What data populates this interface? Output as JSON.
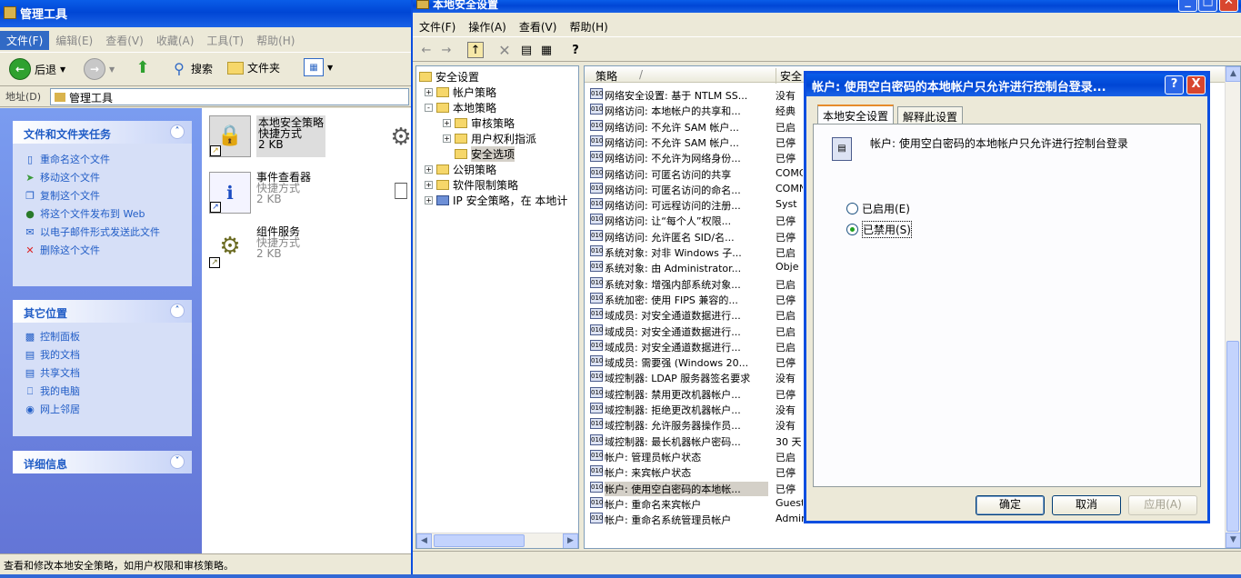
{
  "admin": {
    "title": "管理工具",
    "menu": [
      "文件(F)",
      "编辑(E)",
      "查看(V)",
      "收藏(A)",
      "工具(T)",
      "帮助(H)"
    ],
    "toolbar": {
      "back": "后退",
      "search": "搜索",
      "folders": "文件夹"
    },
    "address_label": "地址(D)",
    "address_value": "管理工具",
    "tasks": {
      "title": "文件和文件夹任务",
      "items": [
        "重命名这个文件",
        "移动这个文件",
        "复制这个文件",
        "将这个文件发布到 Web",
        "以电子邮件形式发送此文件",
        "删除这个文件"
      ]
    },
    "places": {
      "title": "其它位置",
      "items": [
        "控制面板",
        "我的文档",
        "共享文档",
        "我的电脑",
        "网上邻居"
      ]
    },
    "details": {
      "title": "详细信息"
    },
    "files": [
      {
        "name": "本地安全策略",
        "type": "快捷方式",
        "size": "2 KB"
      },
      {
        "name": "事件查看器",
        "type": "快捷方式",
        "size": "2 KB"
      },
      {
        "name": "组件服务",
        "type": "快捷方式",
        "size": "2 KB"
      }
    ],
    "status": "查看和修改本地安全策略，如用户权限和审核策略。"
  },
  "secpol": {
    "title": "本地安全设置",
    "menu": [
      "文件(F)",
      "操作(A)",
      "查看(V)",
      "帮助(H)"
    ],
    "tree": [
      {
        "label": "安全设置"
      },
      {
        "label": "帐户策略"
      },
      {
        "label": "本地策略"
      },
      {
        "label": "审核策略"
      },
      {
        "label": "用户权利指派"
      },
      {
        "label": "安全选项"
      },
      {
        "label": "公钥策略"
      },
      {
        "label": "软件限制策略"
      },
      {
        "label": "IP 安全策略，在 本地计"
      }
    ],
    "columns": {
      "policy": "策略",
      "setting": "安全"
    },
    "rows": [
      {
        "policy": "网络安全设置: 基于 NTLM SS...",
        "setting": "没有"
      },
      {
        "policy": "网络访问: 本地帐户的共享和...",
        "setting": "经典"
      },
      {
        "policy": "网络访问: 不允许 SAM 帐户...",
        "setting": "已启"
      },
      {
        "policy": "网络访问: 不允许 SAM 帐户...",
        "setting": "已停"
      },
      {
        "policy": "网络访问: 不允许为网络身份...",
        "setting": "已停"
      },
      {
        "policy": "网络访问: 可匿名访问的共享",
        "setting": "COMC"
      },
      {
        "policy": "网络访问: 可匿名访问的命名...",
        "setting": "COMN"
      },
      {
        "policy": "网络访问: 可远程访问的注册...",
        "setting": "Syst"
      },
      {
        "policy": "网络访问: 让“每个人”权限...",
        "setting": "已停"
      },
      {
        "policy": "网络访问: 允许匿名 SID/名...",
        "setting": "已停"
      },
      {
        "policy": "系统对象: 对非 Windows 子...",
        "setting": "已启"
      },
      {
        "policy": "系统对象: 由 Administrator...",
        "setting": "Obje"
      },
      {
        "policy": "系统对象: 增强内部系统对象...",
        "setting": "已启"
      },
      {
        "policy": "系统加密: 使用 FIPS 兼容的...",
        "setting": "已停"
      },
      {
        "policy": "域成员: 对安全通道数据进行...",
        "setting": "已启"
      },
      {
        "policy": "域成员: 对安全通道数据进行...",
        "setting": "已启"
      },
      {
        "policy": "域成员: 对安全通道数据进行...",
        "setting": "已启"
      },
      {
        "policy": "域成员: 需要强 (Windows 20...",
        "setting": "已停"
      },
      {
        "policy": "域控制器: LDAP 服务器签名要求",
        "setting": "没有"
      },
      {
        "policy": "域控制器: 禁用更改机器帐户...",
        "setting": "已停"
      },
      {
        "policy": "域控制器: 拒绝更改机器帐户...",
        "setting": "没有"
      },
      {
        "policy": "域控制器: 允许服务器操作员...",
        "setting": "没有"
      },
      {
        "policy": "域控制器: 最长机器帐户密码...",
        "setting": "30 天"
      },
      {
        "policy": "帐户: 管理员帐户状态",
        "setting": "已启"
      },
      {
        "policy": "帐户: 来宾帐户状态",
        "setting": "已停"
      },
      {
        "policy": "帐户: 使用空白密码的本地帐...",
        "setting": "已停"
      },
      {
        "policy": "帐户: 重命名来宾帐户",
        "setting": "Guest"
      },
      {
        "policy": "帐户: 重命名系统管理员帐户",
        "setting": "Administrator"
      }
    ]
  },
  "dialog": {
    "title": "帐户: 使用空白密码的本地帐户只允许进行控制台登录...",
    "tabs": [
      "本地安全设置",
      "解释此设置"
    ],
    "description": "帐户: 使用空白密码的本地帐户只允许进行控制台登录",
    "options": [
      "已启用(E)",
      "已禁用(S)"
    ],
    "selected": "已禁用(S)",
    "buttons": {
      "ok": "确定",
      "cancel": "取消",
      "apply": "应用(A)"
    },
    "help": "?",
    "close": "X"
  }
}
